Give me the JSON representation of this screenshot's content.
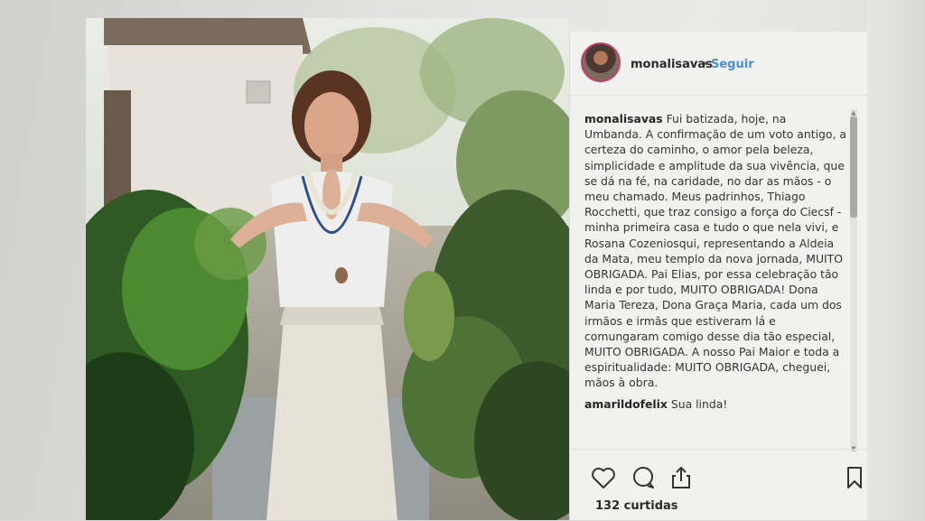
{
  "post": {
    "username": "monalisavas",
    "separator": "•",
    "follow_label": "Seguir",
    "caption_user": "monalisavas",
    "caption_text": "Fui batizada, hoje, na Umbanda. A confirmação de um voto antigo, a certeza do caminho, o amor pela beleza, simplicidade e amplitude da sua vivência, que se dá na fé, na caridade, no dar as mãos - o meu chamado. Meus padrinhos, Thiago Rocchetti, que traz consigo a força do Ciecsf - minha primeira casa e tudo o que nela vivi, e Rosana Cozeniosqui, representando a Aldeia da Mata, meu templo da nova jornada, MUITO OBRIGADA. Pai Elias, por essa celebração tão linda e por tudo, MUITO OBRIGADA! Dona Maria Tereza, Dona Graça Maria, cada um dos irmãos e irmãs que estiveram lá e comungaram comigo desse dia tão especial, MUITO OBRIGADA. A nosso Pai Maior e toda a espiritualidade: MUITO OBRIGADA, cheguei, mãos à obra.",
    "comment_user": "amarildofelix",
    "comment_text": "Sua linda!",
    "likes": "132 curtidas"
  },
  "icons": {
    "like": "heart-icon",
    "comment": "comment-bubble-icon",
    "share": "share-icon",
    "save": "bookmark-icon"
  },
  "colors": {
    "follow": "#4a8fd8",
    "avatar_ring": "#c83c6b",
    "panel_bg": "#f1f1ef"
  }
}
